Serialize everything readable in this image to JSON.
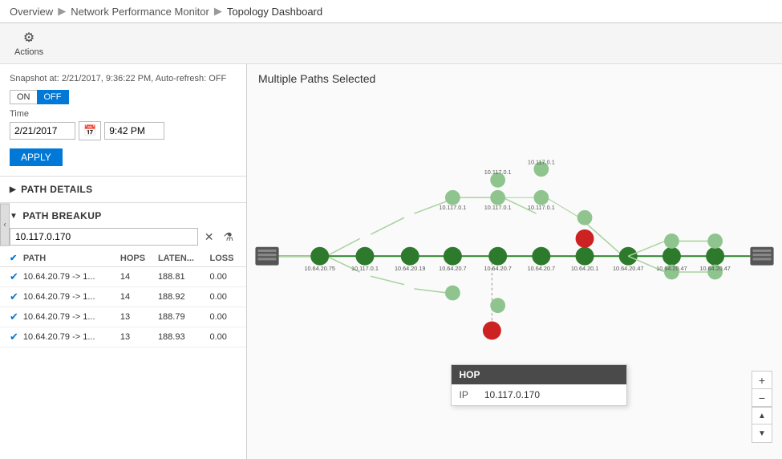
{
  "breadcrumb": {
    "overview": "Overview",
    "monitor": "Network Performance Monitor",
    "dashboard": "Topology Dashboard"
  },
  "toolbar": {
    "actions_label": "Actions",
    "actions_icon": "⚙"
  },
  "left_panel": {
    "snapshot_text": "Snapshot at: 2/21/2017, 9:36:22 PM, Auto-refresh: OFF",
    "toggle_on": "ON",
    "toggle_off": "OFF",
    "time_label": "Time",
    "date_value": "2/21/2017",
    "time_value": "9:42 PM",
    "apply_label": "APPLY",
    "path_details_label": "PATH DETAILS",
    "path_breakup_label": "PATH BREAKUP",
    "search_placeholder": "10.117.0.170",
    "table": {
      "headers": [
        "",
        "PATH",
        "HOPS",
        "LATEN...",
        "LOSS"
      ],
      "rows": [
        {
          "checked": true,
          "path": "10.64.20.79 -> 1...",
          "hops": "14",
          "latency": "188.81",
          "loss": "0.00"
        },
        {
          "checked": true,
          "path": "10.64.20.79 -> 1...",
          "hops": "14",
          "latency": "188.92",
          "loss": "0.00"
        },
        {
          "checked": true,
          "path": "10.64.20.79 -> 1...",
          "hops": "13",
          "latency": "188.79",
          "loss": "0.00"
        },
        {
          "checked": true,
          "path": "10.64.20.79 -> 1...",
          "hops": "13",
          "latency": "188.93",
          "loss": "0.00"
        }
      ]
    }
  },
  "right_panel": {
    "title": "Multiple Paths Selected",
    "hop_tooltip": {
      "header": "HOP",
      "ip_label": "IP",
      "ip_value": "10.117.0.170"
    }
  },
  "zoom_controls": {
    "zoom_in": "+",
    "zoom_out": "−",
    "up": "▲",
    "down": "▼"
  }
}
